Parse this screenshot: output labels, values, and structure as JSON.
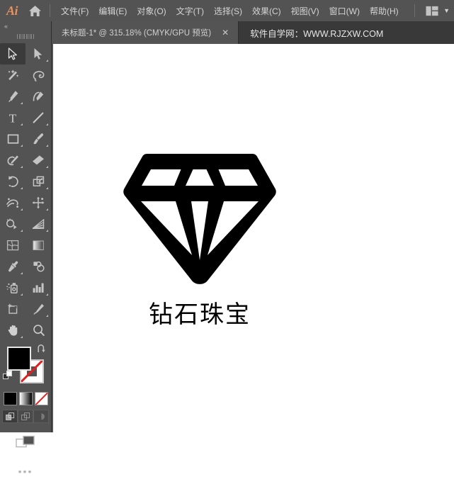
{
  "app": {
    "name": "Ai",
    "logo_color": "#e8915c",
    "home_icon": "home-icon"
  },
  "menubar": {
    "items": [
      {
        "label": "文件(F)"
      },
      {
        "label": "编辑(E)"
      },
      {
        "label": "对象(O)"
      },
      {
        "label": "文字(T)"
      },
      {
        "label": "选择(S)"
      },
      {
        "label": "效果(C)"
      },
      {
        "label": "视图(V)"
      },
      {
        "label": "窗口(W)"
      },
      {
        "label": "帮助(H)"
      }
    ],
    "workspace_switcher_icon": "workspace-layout-icon",
    "workspace_chevron": "▼"
  },
  "tabbar": {
    "tabs": [
      {
        "label": "未标题-1* @ 315.18% (CMYK/GPU 预览)",
        "close_label": "✕",
        "active": true
      }
    ],
    "promo": "软件自学网：WWW.RJZXW.COM"
  },
  "toolpanel": {
    "collapse_label": "«",
    "tools": [
      {
        "name": "selection-tool",
        "active": true,
        "has_flyout": false
      },
      {
        "name": "direct-selection-tool",
        "active": false,
        "has_flyout": true
      },
      {
        "name": "magic-wand-tool",
        "active": false,
        "has_flyout": false
      },
      {
        "name": "lasso-tool",
        "active": false,
        "has_flyout": false
      },
      {
        "name": "pen-tool",
        "active": false,
        "has_flyout": true
      },
      {
        "name": "curvature-tool",
        "active": false,
        "has_flyout": false
      },
      {
        "name": "type-tool",
        "active": false,
        "has_flyout": true
      },
      {
        "name": "line-segment-tool",
        "active": false,
        "has_flyout": true
      },
      {
        "name": "rectangle-tool",
        "active": false,
        "has_flyout": true
      },
      {
        "name": "paintbrush-tool",
        "active": false,
        "has_flyout": true
      },
      {
        "name": "shaper-tool",
        "active": false,
        "has_flyout": true
      },
      {
        "name": "eraser-tool",
        "active": false,
        "has_flyout": true
      },
      {
        "name": "rotate-tool",
        "active": false,
        "has_flyout": true
      },
      {
        "name": "scale-tool",
        "active": false,
        "has_flyout": true
      },
      {
        "name": "width-tool",
        "active": false,
        "has_flyout": true
      },
      {
        "name": "free-transform-tool",
        "active": false,
        "has_flyout": true
      },
      {
        "name": "shape-builder-tool",
        "active": false,
        "has_flyout": true
      },
      {
        "name": "perspective-grid-tool",
        "active": false,
        "has_flyout": true
      },
      {
        "name": "mesh-tool",
        "active": false,
        "has_flyout": false
      },
      {
        "name": "gradient-tool",
        "active": false,
        "has_flyout": false
      },
      {
        "name": "eyedropper-tool",
        "active": false,
        "has_flyout": true
      },
      {
        "name": "blend-tool",
        "active": false,
        "has_flyout": false
      },
      {
        "name": "symbol-sprayer-tool",
        "active": false,
        "has_flyout": true
      },
      {
        "name": "column-graph-tool",
        "active": false,
        "has_flyout": true
      },
      {
        "name": "artboard-tool",
        "active": false,
        "has_flyout": false
      },
      {
        "name": "slice-tool",
        "active": false,
        "has_flyout": true
      },
      {
        "name": "hand-tool",
        "active": false,
        "has_flyout": true
      },
      {
        "name": "zoom-tool",
        "active": false,
        "has_flyout": false
      }
    ],
    "color": {
      "fill": "#000000",
      "stroke": "#ffffff",
      "stroke_is_none": true,
      "swap_icon": "swap-fill-stroke-icon",
      "default_icon": "default-fill-stroke-icon"
    },
    "paint_modes": [
      {
        "name": "color-mode",
        "selected": true
      },
      {
        "name": "gradient-mode",
        "selected": false
      },
      {
        "name": "none-mode",
        "selected": false
      }
    ],
    "draw_modes": [
      {
        "name": "draw-normal",
        "selected": true
      },
      {
        "name": "draw-behind",
        "selected": false
      },
      {
        "name": "draw-inside",
        "selected": false
      }
    ],
    "screen_mode_icon": "screen-mode-icon",
    "more_tools_label": "•••"
  },
  "canvas": {
    "background": "#ffffff",
    "artwork": {
      "name": "diamond-jewelry-logo",
      "shape": "diamond-outline",
      "color": "#000000",
      "caption": "钻石珠宝"
    }
  }
}
